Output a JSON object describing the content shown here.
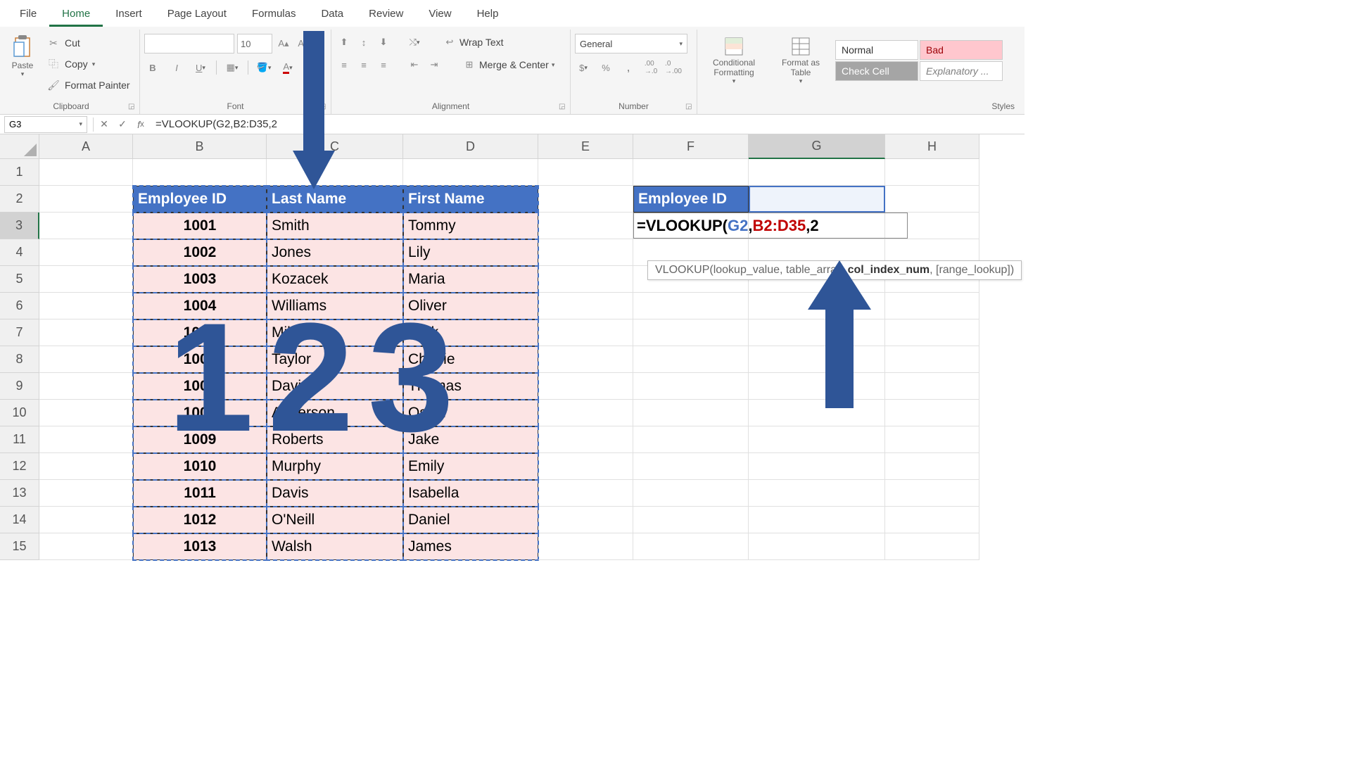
{
  "tabs": [
    "File",
    "Home",
    "Insert",
    "Page Layout",
    "Formulas",
    "Data",
    "Review",
    "View",
    "Help"
  ],
  "active_tab": "Home",
  "clipboard": {
    "paste": "Paste",
    "cut": "Cut",
    "copy": "Copy",
    "format_painter": "Format Painter",
    "label": "Clipboard"
  },
  "font": {
    "size": "10",
    "label": "Font"
  },
  "alignment": {
    "wrap": "Wrap Text",
    "merge": "Merge & Center",
    "label": "Alignment"
  },
  "number": {
    "format": "General",
    "label": "Number"
  },
  "cond_format": "Conditional Formatting",
  "format_table": "Format as Table",
  "styles": {
    "normal": "Normal",
    "bad": "Bad",
    "check": "Check Cell",
    "explanatory": "Explanatory ...",
    "label": "Styles"
  },
  "name_box": "G3",
  "formula": "=VLOOKUP(G2,B2:D35,2",
  "columns": [
    "A",
    "B",
    "C",
    "D",
    "E",
    "F",
    "G",
    "H"
  ],
  "selected_col": "G",
  "selected_row": 3,
  "table": {
    "headers": [
      "Employee ID",
      "Last Name",
      "First Name"
    ],
    "rows": [
      [
        "1001",
        "Smith",
        "Tommy"
      ],
      [
        "1002",
        "Jones",
        "Lily"
      ],
      [
        "1003",
        "Kozacek",
        "Maria"
      ],
      [
        "1004",
        "Williams",
        "Oliver"
      ],
      [
        "1005",
        "Miller",
        "Jack"
      ],
      [
        "1006",
        "Taylor",
        "Charlie"
      ],
      [
        "1007",
        "Davies",
        "Thomas"
      ],
      [
        "1008",
        "Anderson",
        "Oscar"
      ],
      [
        "1009",
        "Roberts",
        "Jake"
      ],
      [
        "1010",
        "Murphy",
        "Emily"
      ],
      [
        "1011",
        "Davis",
        "Isabella"
      ],
      [
        "1012",
        "O'Neill",
        "Daniel"
      ],
      [
        "1013",
        "Walsh",
        "James"
      ]
    ]
  },
  "lookup": {
    "header": "Employee ID"
  },
  "editing_formula": {
    "prefix": "=VLOOKUP(",
    "arg1": "G2",
    "sep1": ",",
    "arg2": "B2:D35",
    "sep2": ",",
    "arg3": "2"
  },
  "tooltip": {
    "fn": "VLOOKUP(lookup_value, table_array, ",
    "bold": "col_index_num",
    "rest": ", [range_lookup])"
  },
  "overlay_numbers": "123"
}
